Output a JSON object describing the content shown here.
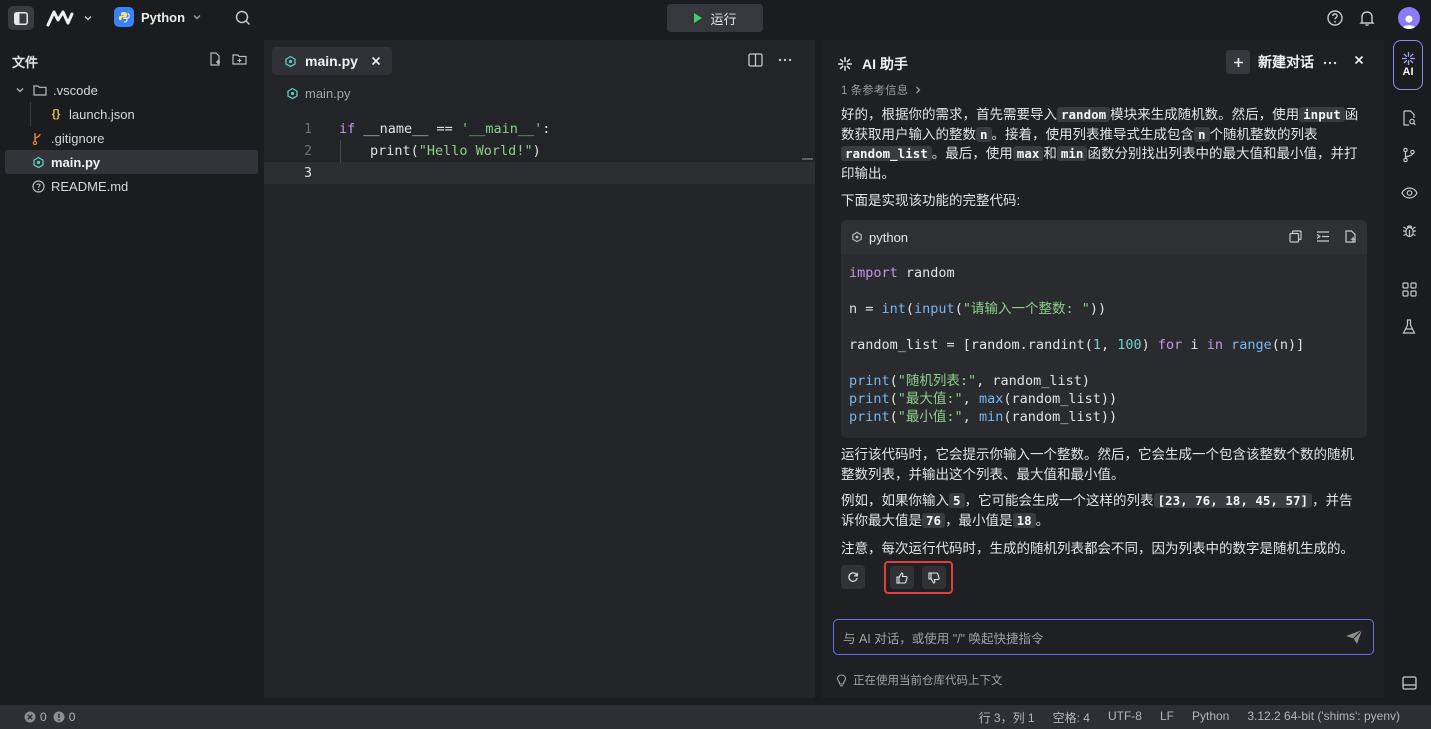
{
  "topbar": {
    "project_name": "Python",
    "run_label": "运行"
  },
  "explorer": {
    "title": "文件",
    "items": [
      {
        "label": ".vscode",
        "type": "folder"
      },
      {
        "label": "launch.json",
        "type": "json"
      },
      {
        "label": ".gitignore",
        "type": "git"
      },
      {
        "label": "main.py",
        "type": "python"
      },
      {
        "label": "README.md",
        "type": "info"
      }
    ]
  },
  "editor": {
    "tab_label": "main.py",
    "breadcrumb": "main.py",
    "line_numbers": [
      "1",
      "2",
      "3"
    ],
    "code": {
      "l1_kw": "if",
      "l1_mid": " __name__ == ",
      "l1_str": "'__main__'",
      "l1_end": ":",
      "l2_fn": "print(",
      "l2_str": "\"Hello World!\"",
      "l2_end": ")"
    }
  },
  "ai": {
    "title": "AI 助手",
    "new_chat_label": "新建对话",
    "ref_info": "1 条参考信息",
    "p1": {
      "t1": "好的，根据你的需求，首先需要导入",
      "c1": "random",
      "t2": "模块来生成随机数。然后，使用",
      "c2": "input",
      "t3": "函数获取用户输入的整数",
      "c3": "n",
      "t4": "。接着，使用列表推导式生成包含",
      "c4": "n",
      "t5": "个随机整数的列表",
      "c5": "random_list",
      "t6": "。最后，使用",
      "c6": "max",
      "t7": "和",
      "c7": "min",
      "t8": "函数分别找出列表中的最大值和最小值，并打印输出。"
    },
    "p2": "下面是实现该功能的完整代码:",
    "codeblock": {
      "lang": "python",
      "l1_kw": "import",
      "l1_rest": " random",
      "l2_a": "n = ",
      "l2_int": "int",
      "l2_b": "(",
      "l2_input": "input",
      "l2_c": "(",
      "l2_str": "\"请输入一个整数: \"",
      "l2_d": "))",
      "l3_a": "random_list = [random.randint(",
      "l3_n1": "1",
      "l3_b": ", ",
      "l3_n2": "100",
      "l3_c": ") ",
      "l3_for": "for",
      "l3_d": " i ",
      "l3_in": "in",
      "l3_e": " ",
      "l3_range": "range",
      "l3_f": "(n)]",
      "l4_fn": "print",
      "l4_a": "(",
      "l4_str": "\"随机列表:\"",
      "l4_b": ", random_list)",
      "l5_fn": "print",
      "l5_a": "(",
      "l5_str": "\"最大值:\"",
      "l5_b": ", ",
      "l5_max": "max",
      "l5_c": "(random_list))",
      "l6_fn": "print",
      "l6_a": "(",
      "l6_str": "\"最小值:\"",
      "l6_b": ", ",
      "l6_min": "min",
      "l6_c": "(random_list))"
    },
    "p3": "运行该代码时，它会提示你输入一个整数。然后，它会生成一个包含该整数个数的随机整数列表，并输出这个列表、最大值和最小值。",
    "p4": {
      "t1": "例如，如果你输入",
      "c1": "5",
      "t2": "，它可能会生成一个这样的列表",
      "c2": "[23, 76, 18, 45, 57]",
      "t3": "，并告诉你最大值是",
      "c3": "76",
      "t4": "，最小值是",
      "c4": "18",
      "t5": "。"
    },
    "p5": "注意，每次运行代码时，生成的随机列表都会不同，因为列表中的数字是随机生成的。",
    "input_placeholder": "与 AI 对话，或使用 \"/\" 唤起快捷指令",
    "context_note": "正在使用当前仓库代码上下文"
  },
  "rail": {
    "ai_label": "AI"
  },
  "status": {
    "errors": "0",
    "warnings": "0",
    "position": "行 3，列 1",
    "spaces": "空格: 4",
    "encoding": "UTF-8",
    "eol": "LF",
    "language": "Python",
    "interpreter": "3.12.2 64-bit ('shims': pyenv)"
  },
  "colors": {
    "accent": "#6a6cf0",
    "highlight_border": "#e0403a",
    "run_icon": "#3ecf6b"
  }
}
